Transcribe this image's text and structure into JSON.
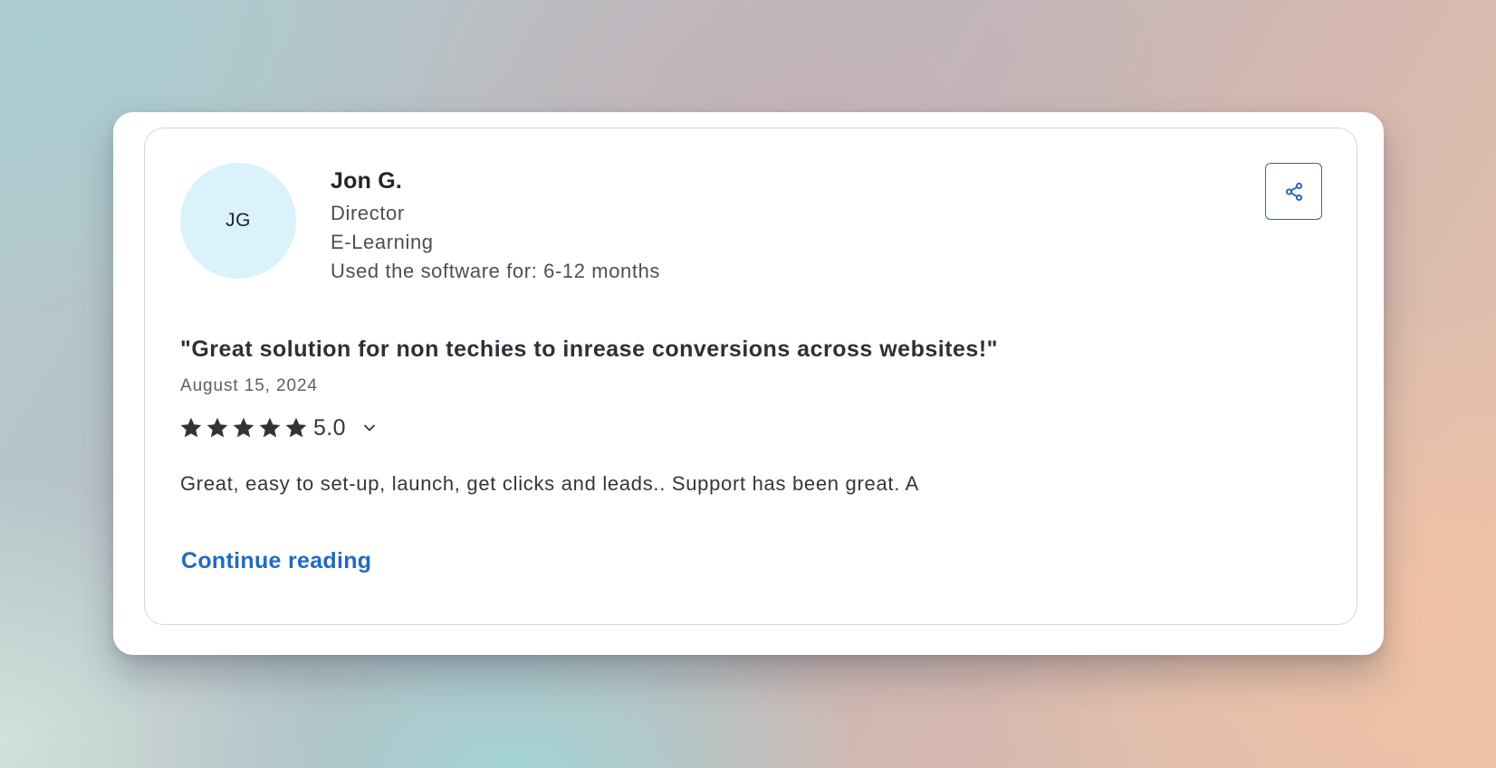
{
  "reviewer": {
    "initials": "JG",
    "name": "Jon G.",
    "role": "Director",
    "industry": "E-Learning",
    "usage": "Used the software for: 6-12 months"
  },
  "review": {
    "title": "\"Great solution for non techies to inrease conversions across websites!\"",
    "date": "August 15, 2024",
    "rating": 5,
    "rating_label": "5.0",
    "excerpt": "Great, easy to set-up, launch, get clicks and leads.. Support has been great. A",
    "continue_label": "Continue reading"
  },
  "icons": {
    "share": "share-icon",
    "star": "star-icon",
    "expand": "chevron-down-icon"
  },
  "colors": {
    "accent": "#1e6bc4",
    "avatar_bg": "#d9f2fb",
    "star": "#333333"
  }
}
